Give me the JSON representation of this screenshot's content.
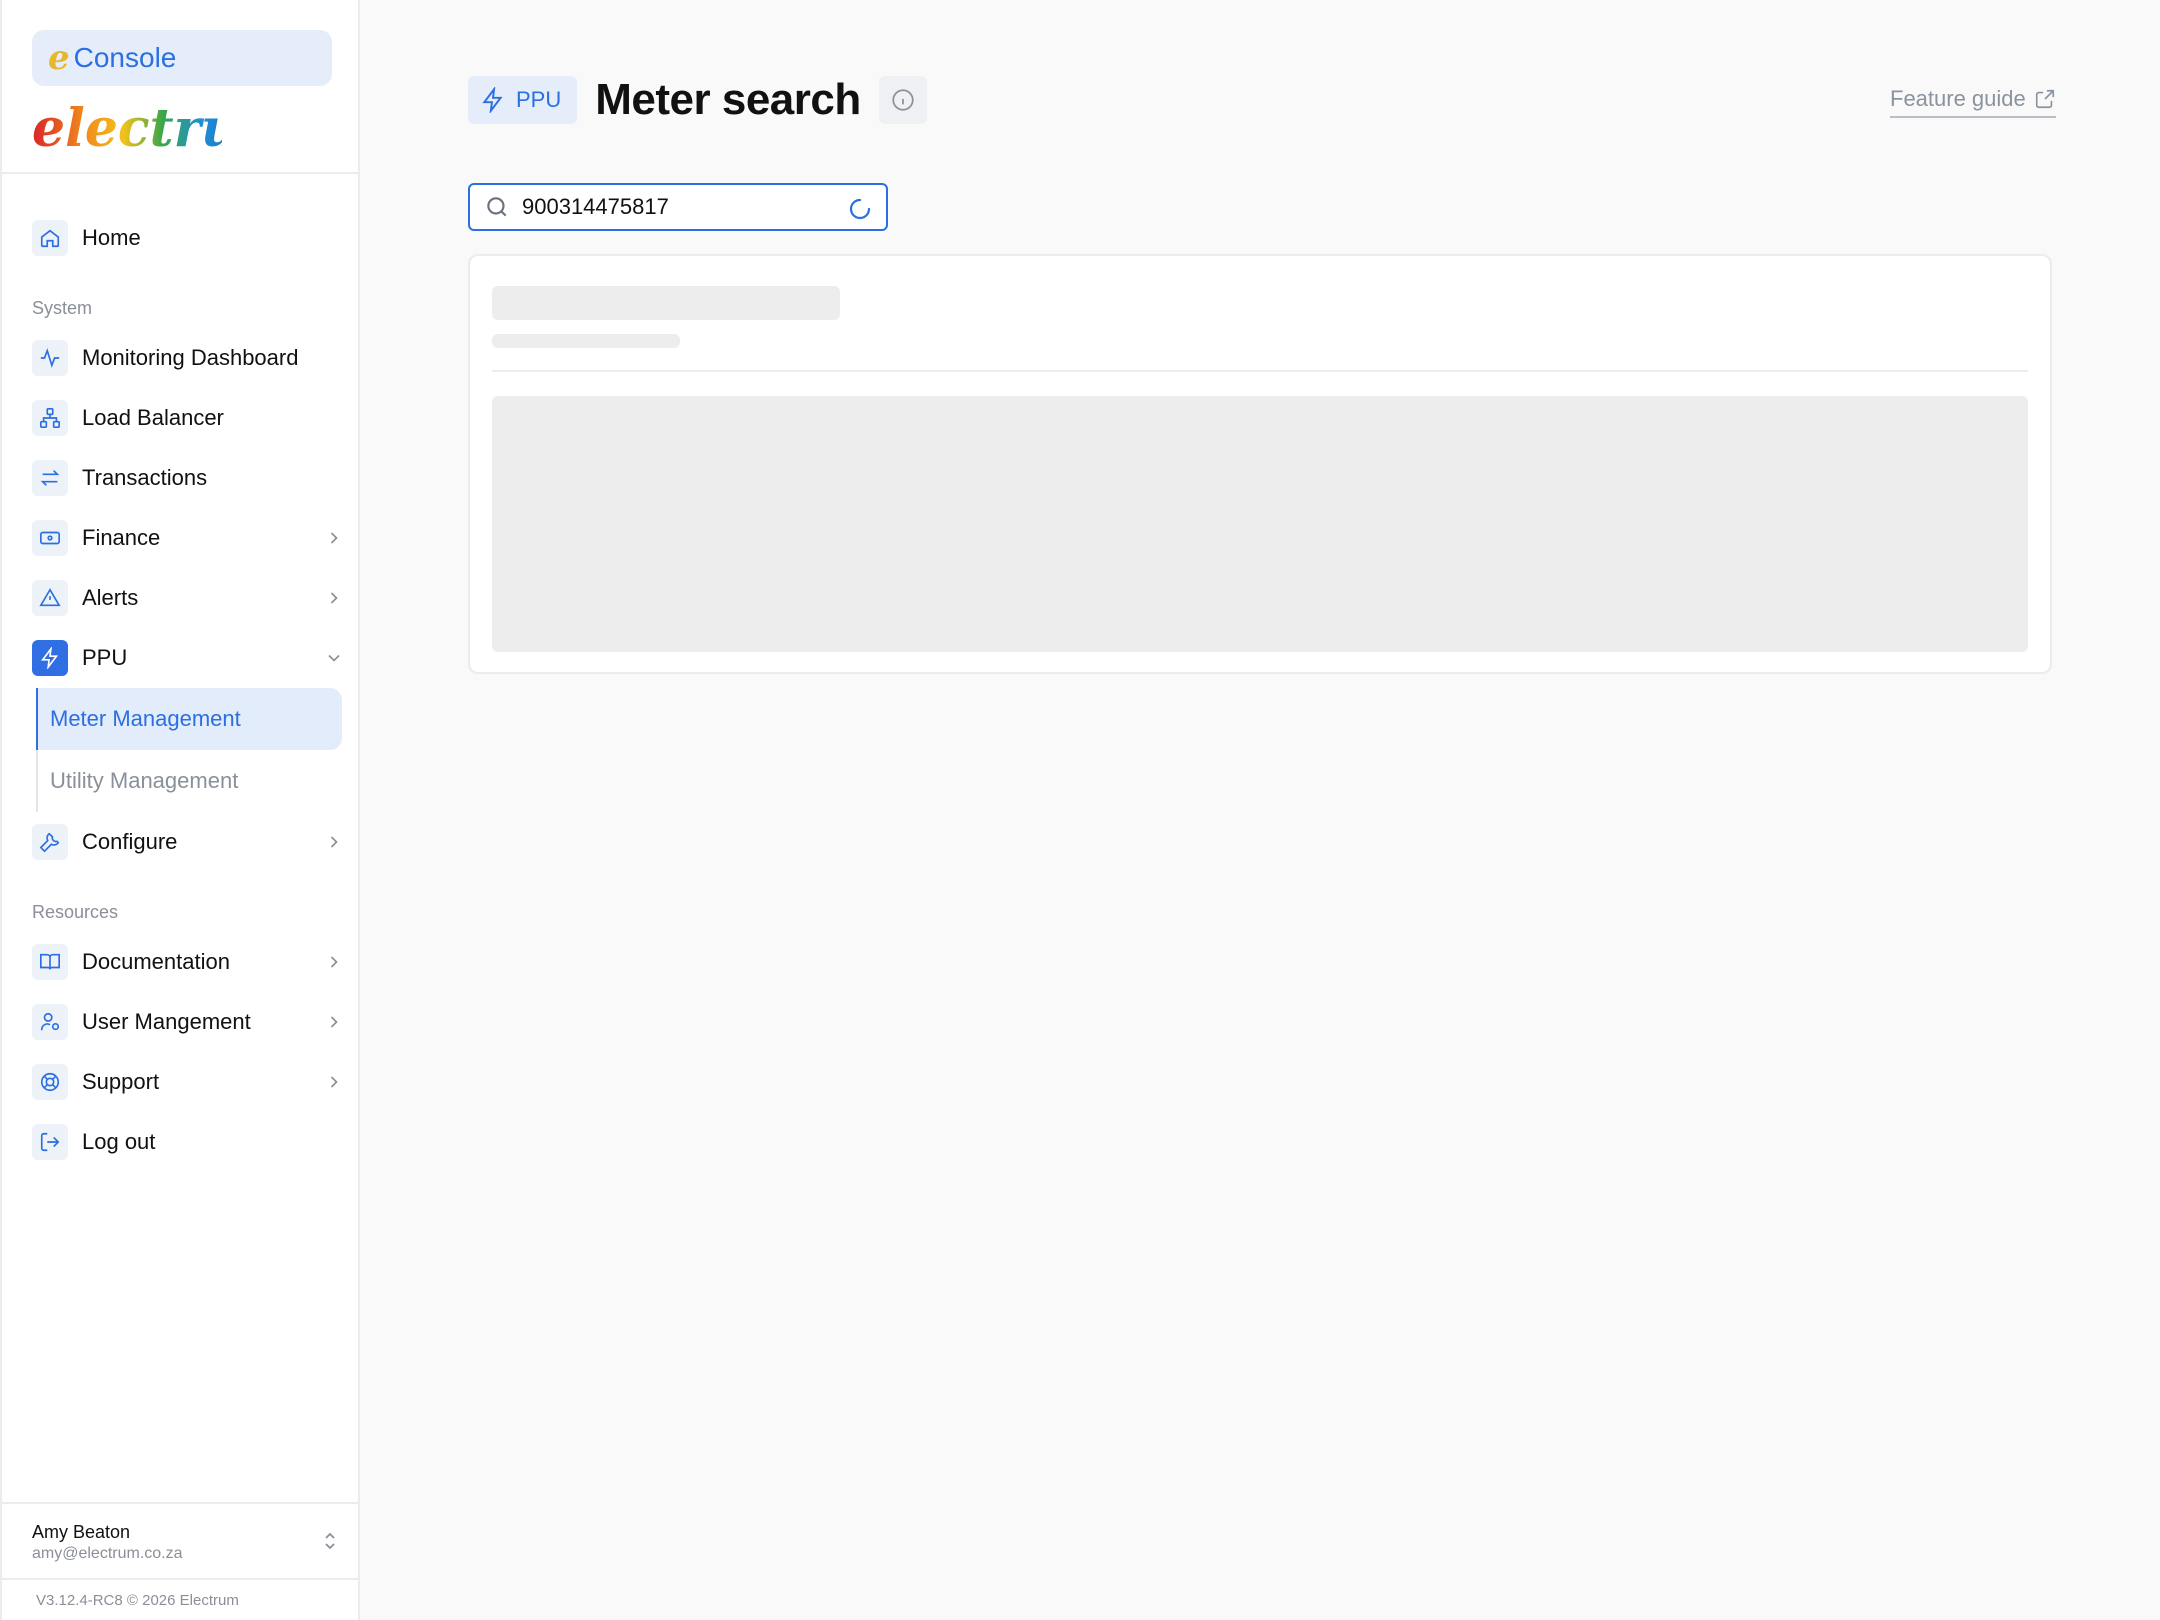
{
  "brand": {
    "console_label": "Console",
    "logo_text": "electrum"
  },
  "nav": {
    "home": "Home",
    "system_section": "System",
    "monitoring": "Monitoring Dashboard",
    "load_balancer": "Load Balancer",
    "transactions": "Transactions",
    "finance": "Finance",
    "alerts": "Alerts",
    "ppu": "PPU",
    "ppu_sub": {
      "meter_management": "Meter Management",
      "utility_management": "Utility Management"
    },
    "configure": "Configure",
    "resources_section": "Resources",
    "documentation": "Documentation",
    "user_management": "User Mangement",
    "support": "Support",
    "logout": "Log out"
  },
  "user": {
    "name": "Amy Beaton",
    "email": "amy@electrum.co.za"
  },
  "version": "V3.12.4-RC8 © 2026 Electrum",
  "header": {
    "badge": "PPU",
    "title": "Meter search",
    "feature_guide": "Feature guide"
  },
  "search": {
    "value": "900314475817"
  },
  "colors": {
    "accent": "#2b6fe0",
    "accent_bg": "#e5edfa",
    "skeleton": "#ededee",
    "background": "#f9f9f9"
  }
}
